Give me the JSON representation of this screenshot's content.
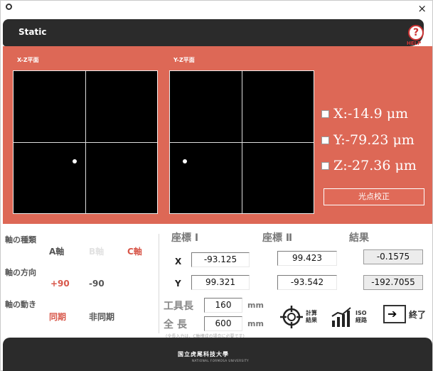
{
  "window": {
    "title": "Static",
    "close_glyph": "×"
  },
  "help": {
    "label": "HELP",
    "icon": "help-icon"
  },
  "planes": {
    "xz": {
      "label": "X-Z平面",
      "point": [
        -14.9,
        -27.36
      ]
    },
    "yz": {
      "label": "Y-Z平面",
      "point": [
        -79.23,
        -27.36
      ]
    }
  },
  "readouts": [
    {
      "text": "X:-14.9 μm",
      "checked": false
    },
    {
      "text": "Y:-79.23 μm",
      "checked": false
    },
    {
      "text": "Z:-27.36 μm",
      "checked": false
    }
  ],
  "calib_button": "光点校正",
  "axis_type": {
    "label": "軸の種類",
    "options": [
      "A軸",
      "B軸",
      "C軸"
    ]
  },
  "axis_direction": {
    "label": "軸の方向",
    "options": [
      "+90",
      "-90"
    ]
  },
  "axis_motion": {
    "label": "軸の動き",
    "options": [
      "同期",
      "非同期"
    ]
  },
  "coords": {
    "head1": "座標 Ⅰ",
    "head2": "座標 Ⅱ",
    "head3": "結果",
    "row_x": {
      "label": "X",
      "c1": "-93.125",
      "c2": "99.423",
      "result": "-0.1575"
    },
    "row_y": {
      "label": "Y",
      "c1": "99.321",
      "c2": "-93.542",
      "result": "-192.7055"
    }
  },
  "tool_length": {
    "label": "工具長",
    "value": "160",
    "unit": "mm"
  },
  "full_length": {
    "label": "全 長",
    "value": "600",
    "unit": "mm"
  },
  "note": "(全長入力は、C軸構成の場合に必要です)",
  "tools": {
    "calc": {
      "line1": "計算",
      "line2": "結果"
    },
    "iso": {
      "line1": "ISO",
      "line2": "経路"
    },
    "end": "終了"
  },
  "footer": {
    "org": "国立虎尾科技大學",
    "org_sub": "NATIONAL FORMOSA UNIVERSITY"
  },
  "colors": {
    "accent": "#dd6856",
    "dark": "#2b2b2b"
  }
}
